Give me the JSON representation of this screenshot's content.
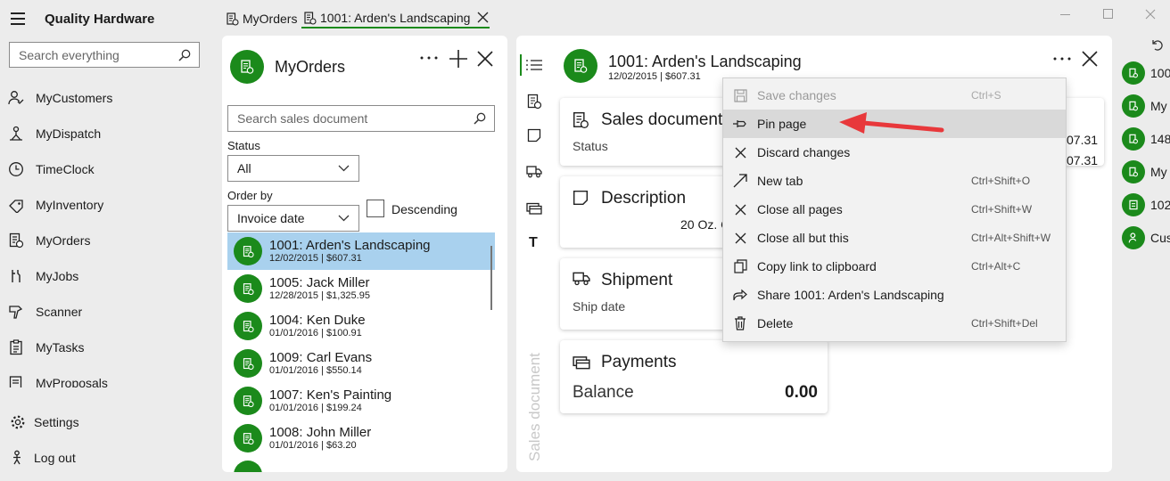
{
  "app": {
    "title": "Quality Hardware"
  },
  "search": {
    "placeholder": "Search everything"
  },
  "nav": {
    "items": [
      {
        "label": "MyCustomers",
        "icon": "customers-icon"
      },
      {
        "label": "MyDispatch",
        "icon": "dispatch-icon"
      },
      {
        "label": "TimeClock",
        "icon": "clock-icon"
      },
      {
        "label": "MyInventory",
        "icon": "inventory-icon"
      },
      {
        "label": "MyOrders",
        "icon": "orders-icon"
      },
      {
        "label": "MyJobs",
        "icon": "jobs-icon"
      },
      {
        "label": "Scanner",
        "icon": "scanner-icon"
      },
      {
        "label": "MyTasks",
        "icon": "tasks-icon"
      },
      {
        "label": "MyProposals",
        "icon": "proposals-icon"
      }
    ],
    "settings": "Settings",
    "logout": "Log out"
  },
  "tabs": [
    {
      "label": "MyOrders"
    },
    {
      "label": "1001: Arden's Landscaping"
    }
  ],
  "orders_panel": {
    "title": "MyOrders",
    "search_placeholder": "Search sales document",
    "status_label": "Status",
    "status_value": "All",
    "orderby_label": "Order by",
    "orderby_value": "Invoice date",
    "descending_label": "Descending",
    "orders": [
      {
        "title": "1001: Arden's Landscaping",
        "sub": "12/02/2015 | $607.31"
      },
      {
        "title": "1005: Jack Miller",
        "sub": "12/28/2015 | $1,325.95"
      },
      {
        "title": "1004: Ken Duke",
        "sub": "01/01/2016 | $100.91"
      },
      {
        "title": "1009: Carl Evans",
        "sub": "01/01/2016 | $550.14"
      },
      {
        "title": "1007: Ken's Painting",
        "sub": "01/01/2016 | $199.24"
      },
      {
        "title": "1008: John Miller",
        "sub": "01/01/2016 | $63.20"
      }
    ]
  },
  "detail": {
    "title": "1001: Arden's Landscaping",
    "sub": "12/02/2015 | $607.31",
    "vertical_label": "Sales document",
    "cards": {
      "sales": {
        "title": "Sales document",
        "status_label": "Status",
        "val1": "07.31",
        "val2": "07.31"
      },
      "description": {
        "title": "Description",
        "text": "20 Oz. C"
      },
      "shipment": {
        "title": "Shipment",
        "ship_label": "Ship date"
      },
      "payments": {
        "title": "Payments",
        "balance_label": "Balance",
        "balance_value": "0.00"
      }
    },
    "sidebar_t": "T"
  },
  "context_menu": {
    "items": [
      {
        "label": "Save changes",
        "shortcut": "Ctrl+S"
      },
      {
        "label": "Pin page",
        "shortcut": ""
      },
      {
        "label": "Discard changes",
        "shortcut": ""
      },
      {
        "label": "New tab",
        "shortcut": "Ctrl+Shift+O"
      },
      {
        "label": "Close all pages",
        "shortcut": "Ctrl+Shift+W"
      },
      {
        "label": "Close all but this",
        "shortcut": "Ctrl+Alt+Shift+W"
      },
      {
        "label": "Copy link to clipboard",
        "shortcut": "Ctrl+Alt+C"
      },
      {
        "label": "Share 1001: Arden's Landscaping",
        "shortcut": ""
      },
      {
        "label": "Delete",
        "shortcut": "Ctrl+Shift+Del"
      }
    ]
  },
  "recent": [
    {
      "label": "100"
    },
    {
      "label": "My"
    },
    {
      "label": "148"
    },
    {
      "label": "My"
    },
    {
      "label": "102"
    },
    {
      "label": "Cus"
    }
  ],
  "colors": {
    "accent": "#1b8a1b",
    "selection": "#a9d1ee",
    "arrow": "#e8383b"
  }
}
